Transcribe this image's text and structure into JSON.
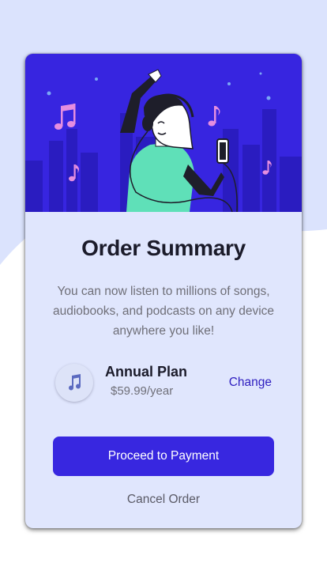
{
  "card": {
    "title": "Order Summary",
    "description": "You can now listen to millions of songs, audiobooks, and podcasts on any device anywhere you like!"
  },
  "plan": {
    "name": "Annual Plan",
    "price": "$59.99/year",
    "change_label": "Change",
    "icon": "music-note-icon"
  },
  "actions": {
    "proceed_label": "Proceed to Payment",
    "cancel_label": "Cancel Order"
  },
  "colors": {
    "background_pattern": "#dbe3fd",
    "card_background": "#e0e6fd",
    "accent": "#3827e0",
    "change_link": "#3020c0",
    "title": "#1b1b2a",
    "muted_text": "#6f6f78"
  }
}
